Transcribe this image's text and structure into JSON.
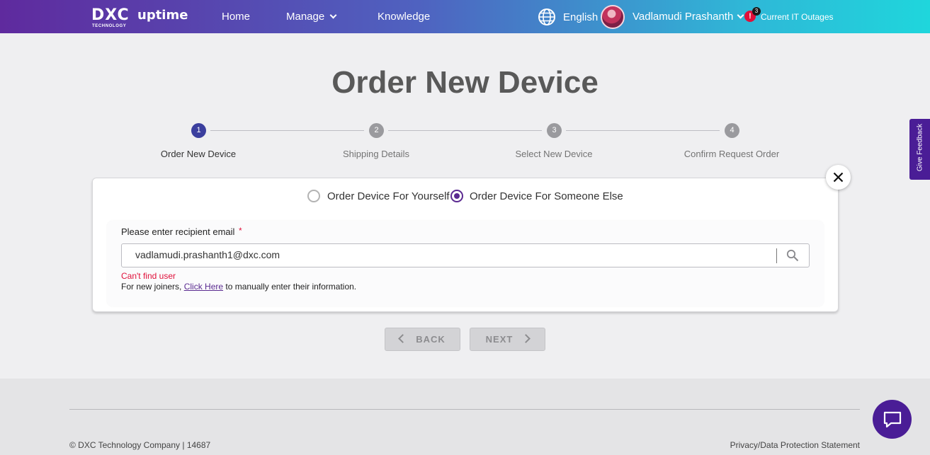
{
  "header": {
    "logo_mark": "DXC",
    "logo_sub": "TECHNOLOGY",
    "brand": "uptime",
    "nav": {
      "home": "Home",
      "manage": "Manage",
      "knowledge": "Knowledge"
    },
    "language": "English",
    "user_name": "Vadlamudi Prashanth",
    "alert_symbol": "!",
    "alert_count": "3",
    "outages_label": "Current IT Outages"
  },
  "page": {
    "title": "Order New Device"
  },
  "stepper": {
    "steps": [
      {
        "number": "1",
        "label": "Order New Device"
      },
      {
        "number": "2",
        "label": "Shipping Details"
      },
      {
        "number": "3",
        "label": "Select New Device"
      },
      {
        "number": "4",
        "label": "Confirm Request Order"
      }
    ]
  },
  "form": {
    "radio_options": [
      {
        "label": "Order Device For Yourself",
        "checked": false
      },
      {
        "label": "Order Device For Someone Else",
        "checked": true
      }
    ],
    "email_label": "Please enter recipient email",
    "required_mark": "*",
    "email_value": "vadlamudi.prashanth1@dxc.com",
    "error": "Can't find user",
    "help_prefix": "For new joiners, ",
    "help_link": "Click Here",
    "help_suffix": " to manually enter their information."
  },
  "buttons": {
    "back": "BACK",
    "next": "NEXT"
  },
  "feedback": "Give Feedback",
  "footer": {
    "copyright": "© DXC Technology Company | 14687",
    "privacy": "Privacy/Data Protection Statement"
  },
  "colors": {
    "accent": "#5b2a91",
    "active_step": "#3b3f9e",
    "error": "#e0103a"
  }
}
